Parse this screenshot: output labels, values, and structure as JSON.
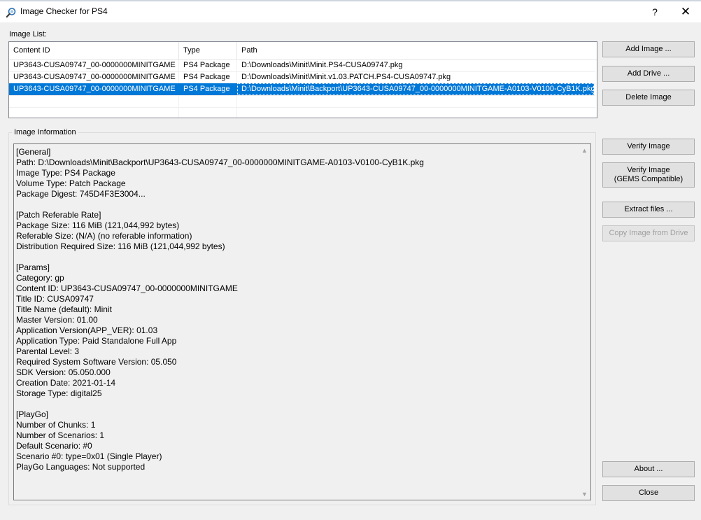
{
  "window": {
    "title": "Image Checker for PS4",
    "help_label": "?",
    "close_label": "✕",
    "icon": "magnifier-app-icon"
  },
  "image_list": {
    "label": "Image List:",
    "columns": [
      "Content ID",
      "Type",
      "Path"
    ],
    "rows": [
      {
        "content_id": "UP3643-CUSA09747_00-0000000MINITGAME",
        "type": "PS4 Package",
        "path": "D:\\Downloads\\Minit\\Minit.PS4-CUSA09747.pkg",
        "selected": false
      },
      {
        "content_id": "UP3643-CUSA09747_00-0000000MINITGAME",
        "type": "PS4 Package",
        "path": "D:\\Downloads\\Minit\\Minit.v1.03.PATCH.PS4-CUSA09747.pkg",
        "selected": false
      },
      {
        "content_id": "UP3643-CUSA09747_00-0000000MINITGAME",
        "type": "PS4 Package",
        "path": "D:\\Downloads\\Minit\\Backport\\UP3643-CUSA09747_00-0000000MINITGAME-A0103-V0100-CyB1K.pkg",
        "selected": true
      }
    ],
    "selection_color": "#0078d7"
  },
  "image_information": {
    "label": "Image Information",
    "lines": [
      "[General]",
      "Path: D:\\Downloads\\Minit\\Backport\\UP3643-CUSA09747_00-0000000MINITGAME-A0103-V0100-CyB1K.pkg",
      "Image Type: PS4 Package",
      "Volume Type: Patch Package",
      "Package Digest: 745D4F3E3004...",
      "",
      "[Patch Referable Rate]",
      "Package Size: 116 MiB (121,044,992 bytes)",
      "Referable Size: (N/A) (no referable information)",
      "Distribution Required Size: 116 MiB (121,044,992 bytes)",
      "",
      "[Params]",
      "Category: gp",
      "Content ID: UP3643-CUSA09747_00-0000000MINITGAME",
      "Title ID: CUSA09747",
      "Title Name (default): Minit",
      "Master Version: 01.00",
      "Application Version(APP_VER): 01.03",
      "Application Type: Paid Standalone Full App",
      "Parental Level: 3",
      "Required System Software Version: 05.050",
      "SDK Version: 05.050.000",
      "Creation Date: 2021-01-14",
      "Storage Type: digital25",
      "",
      "[PlayGo]",
      "Number of Chunks: 1",
      "Number of Scenarios: 1",
      "Default Scenario: #0",
      "Scenario #0: type=0x01 (Single Player)",
      "PlayGo Languages: Not supported"
    ]
  },
  "buttons": {
    "add_image": "Add Image ...",
    "add_drive": "Add Drive ...",
    "delete_image": "Delete Image",
    "verify_image": "Verify Image",
    "verify_gems_line1": "Verify Image",
    "verify_gems_line2": "(GEMS Compatible)",
    "extract_files": "Extract files ...",
    "copy_from_drive": "Copy Image from Drive",
    "about": "About ...",
    "close": "Close"
  },
  "scrollbar": {
    "up_arrow": "▲",
    "down_arrow": "▼"
  }
}
